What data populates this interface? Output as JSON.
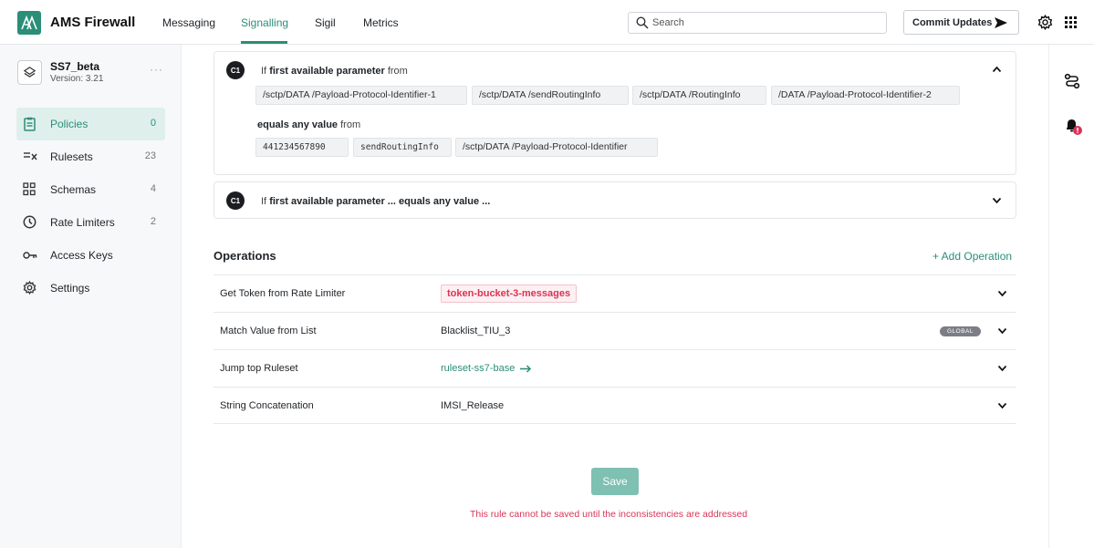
{
  "app": {
    "brand": "AMS Firewall",
    "colors": {
      "accent": "#2a8e78",
      "error": "#d93457"
    }
  },
  "nav": {
    "tabs": [
      {
        "label": "Messaging",
        "active": false
      },
      {
        "label": "Signalling",
        "active": true
      },
      {
        "label": "Sigil",
        "active": false
      },
      {
        "label": "Metrics",
        "active": false
      }
    ]
  },
  "search": {
    "placeholder": "Search",
    "value": ""
  },
  "toolbar": {
    "commit_label": "Commit Updates"
  },
  "project": {
    "name": "SS7_beta",
    "version": "Version: 3.21",
    "more": "···"
  },
  "sidebar": {
    "items": [
      {
        "label": "Policies",
        "count": "0",
        "icon": "clipboard-icon",
        "active": true
      },
      {
        "label": "Rulesets",
        "count": "23",
        "icon": "list-check-icon",
        "active": false
      },
      {
        "label": "Schemas",
        "count": "4",
        "icon": "schema-grid-icon",
        "active": false
      },
      {
        "label": "Rate Limiters",
        "count": "2",
        "icon": "clock-icon",
        "active": false
      },
      {
        "label": "Access Keys",
        "count": "",
        "icon": "key-icon",
        "active": false
      },
      {
        "label": "Settings",
        "count": "",
        "icon": "gear-icon",
        "active": false
      }
    ]
  },
  "conditions": [
    {
      "badge": "C1",
      "prefix": "If",
      "param_label": "first available parameter",
      "from_label": "from",
      "expanded": true,
      "params": [
        "/sctp/DATA /Payload-Protocol-Identifier-1",
        "/sctp/DATA /sendRoutingInfo",
        "/sctp/DATA /RoutingInfo",
        "/DATA /Payload-Protocol-Identifier-2"
      ],
      "match_label": "equals any value",
      "match_from": "from",
      "values": [
        "441234567890",
        "sendRoutingInfo",
        "/sctp/DATA /Payload-Protocol-Identifier"
      ]
    },
    {
      "badge": "C1",
      "prefix": "If",
      "summary": "first available parameter ... equals any value ...",
      "expanded": false
    }
  ],
  "operations": {
    "title": "Operations",
    "add_label": "+ Add Operation",
    "rows": [
      {
        "name": "Get Token from Rate Limiter",
        "value": "token-bucket-3-messages",
        "style": "error-badge"
      },
      {
        "name": "Match Value from List",
        "value": "Blacklist_TIU_3",
        "tag": "GLOBAL"
      },
      {
        "name": "Jump top Ruleset",
        "value": "ruleset-ss7-base",
        "style": "link"
      },
      {
        "name": "String Concatenation",
        "value": "IMSI_Release"
      }
    ]
  },
  "save": {
    "label": "Save",
    "error": "This rule cannot be saved until the inconsistencies are addressed"
  }
}
